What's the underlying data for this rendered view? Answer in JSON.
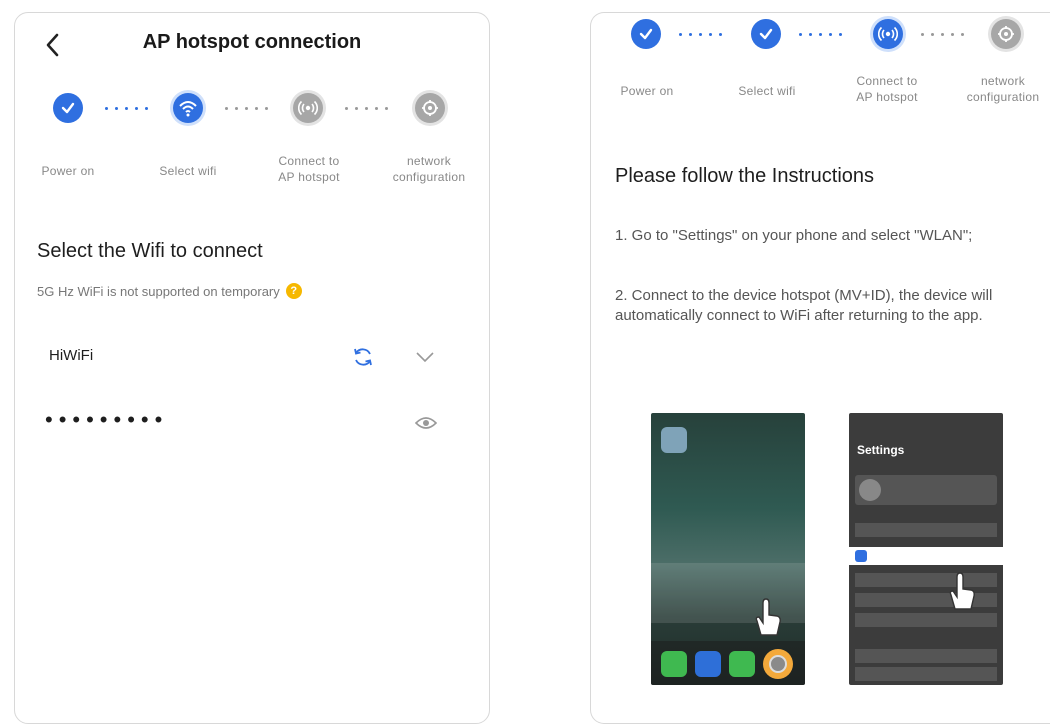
{
  "left": {
    "title": "AP hotspot connection",
    "steps": [
      {
        "label": "Power on",
        "state": "done",
        "icon": "check-icon"
      },
      {
        "label": "Select wifi",
        "state": "active",
        "icon": "wifi-icon"
      },
      {
        "label": "Connect to\nAP hotspot",
        "state": "pending",
        "icon": "hotspot-icon"
      },
      {
        "label": "network\nconfiguration",
        "state": "pending",
        "icon": "network-config-icon"
      }
    ],
    "section_title": "Select the Wifi to connect",
    "note": "5G Hz WiFi is not supported on temporary",
    "note_icon": "question-icon",
    "wifi_name": "HiWiFi",
    "password_mask": "•••••••••"
  },
  "right": {
    "steps": [
      {
        "label": "Power on",
        "state": "done",
        "icon": "check-icon"
      },
      {
        "label": "Select wifi",
        "state": "done",
        "icon": "check-icon"
      },
      {
        "label": "Connect to\nAP hotspot",
        "state": "active",
        "icon": "hotspot-icon"
      },
      {
        "label": "network\nconfiguration",
        "state": "pending",
        "icon": "network-config-icon"
      }
    ],
    "section_title": "Please follow the Instructions",
    "instruction_1": "1. Go to \"Settings\" on your phone and select \"WLAN\";",
    "instruction_2": "2. Connect to the device hotspot (MV+ID), the device will automatically connect to WiFi after returning to the app.",
    "settings_title": "Settings"
  },
  "colors": {
    "accent": "#2f6fe0",
    "pending": "#a7a7a7",
    "warning": "#f6b800"
  }
}
